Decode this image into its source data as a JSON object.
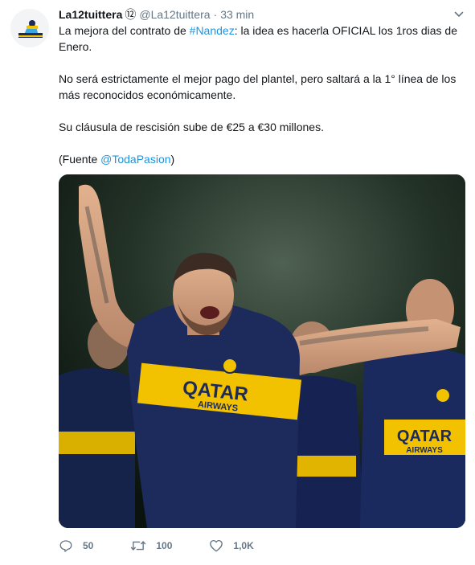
{
  "author": {
    "display_name": "La12tuittera",
    "badge": "⑫",
    "handle": "@La12tuittera",
    "separator": "·",
    "time": "33 min"
  },
  "tweet": {
    "line1_prefix": "La mejora del contrato de ",
    "hashtag": "#Nandez",
    "line1_suffix": ": la idea es hacerla OFICIAL los 1ros dias de Enero.",
    "paragraph2": "No será estrictamente el mejor pago del plantel, pero saltará a la 1° línea de los más reconocidos económicamente.",
    "paragraph3": "Su cláusula de rescisión sube de €25 a €30 millones.",
    "source_prefix": "(Fuente ",
    "mention": "@TodaPasion",
    "source_suffix": ")"
  },
  "media": {
    "jersey_sponsor_top": "QATAR",
    "jersey_sponsor_bottom": "AIRWAYS"
  },
  "actions": {
    "replies": "50",
    "retweets": "100",
    "likes": "1,0K"
  },
  "colors": {
    "link": "#1b95e0",
    "muted": "#657786",
    "text": "#14171a",
    "jersey_blue": "#1c2a5c",
    "jersey_yellow": "#f2c200"
  },
  "icons": {
    "caret": "chevron-down-icon",
    "reply": "reply-icon",
    "retweet": "retweet-icon",
    "like": "heart-icon"
  }
}
